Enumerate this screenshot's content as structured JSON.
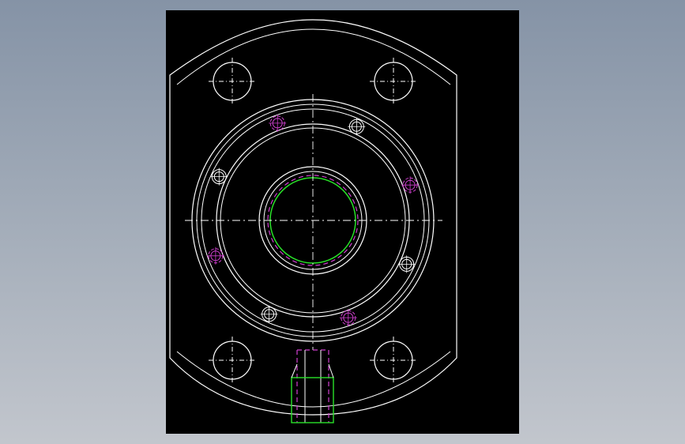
{
  "viewport": {
    "background": "#000000"
  },
  "colors": {
    "outline": "#ffffff",
    "centerline": "#ffffff",
    "hidden": "#d040d0",
    "bore_green": "#28e028",
    "port_green": "#28e028"
  },
  "elements": {
    "body_outline": "flange-plate-outline",
    "mounting_holes": [
      "corner-hole-top-left",
      "corner-hole-top-right",
      "corner-hole-bottom-left",
      "corner-hole-bottom-right"
    ],
    "bolt_circle_screws": 8,
    "central_bore": "bore",
    "bottom_port": "threaded-port"
  }
}
